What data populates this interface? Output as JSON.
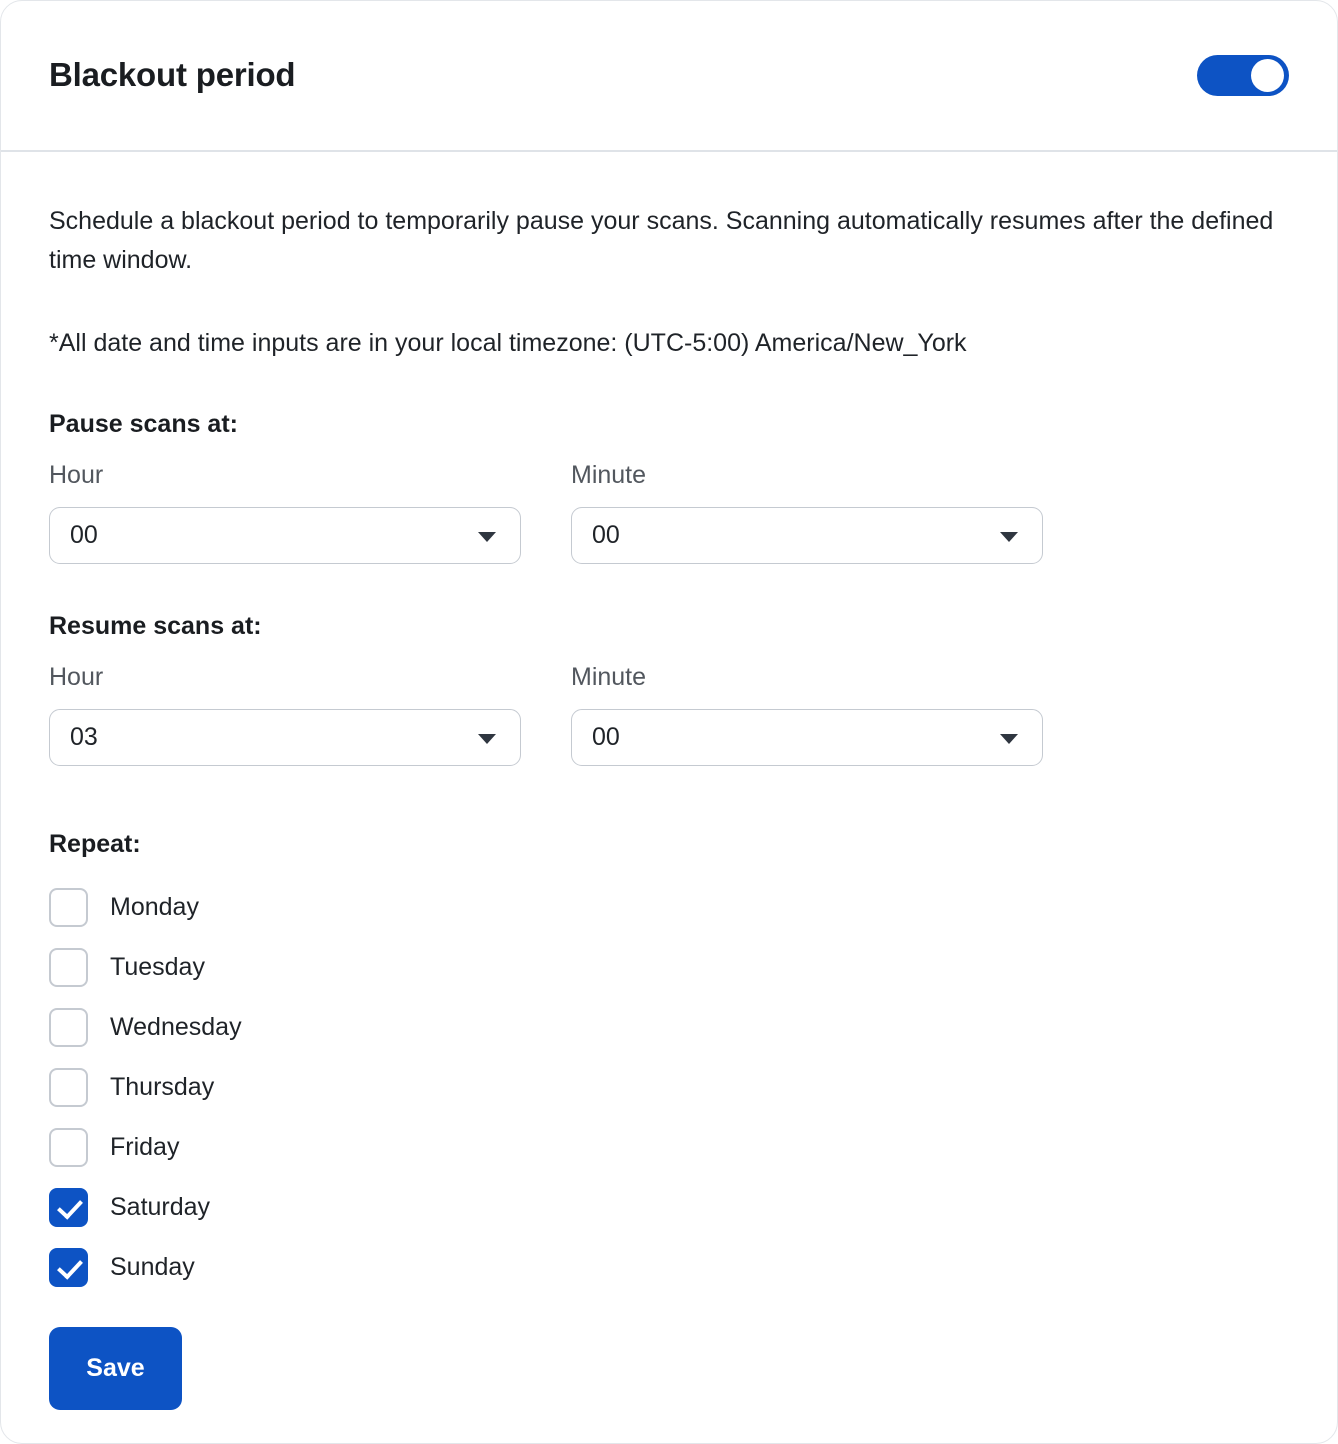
{
  "card": {
    "title": "Blackout period",
    "enabled_toggle": {
      "state": "on",
      "accent_color": "#0d53c4"
    },
    "description": "Schedule a blackout period to temporarily pause your scans. Scanning automatically resumes after the defined time window.",
    "timezone_note": "*All date and time inputs are in your local timezone: (UTC-5:00) America/New_York",
    "pause": {
      "label": "Pause scans at:",
      "hour": {
        "label": "Hour",
        "value": "00"
      },
      "minute": {
        "label": "Minute",
        "value": "00"
      }
    },
    "resume": {
      "label": "Resume scans at:",
      "hour": {
        "label": "Hour",
        "value": "03"
      },
      "minute": {
        "label": "Minute",
        "value": "00"
      }
    },
    "repeat": {
      "label": "Repeat:",
      "days": [
        {
          "label": "Monday",
          "checked": false
        },
        {
          "label": "Tuesday",
          "checked": false
        },
        {
          "label": "Wednesday",
          "checked": false
        },
        {
          "label": "Thursday",
          "checked": false
        },
        {
          "label": "Friday",
          "checked": false
        },
        {
          "label": "Saturday",
          "checked": true
        },
        {
          "label": "Sunday",
          "checked": true
        }
      ]
    },
    "save_label": "Save"
  }
}
